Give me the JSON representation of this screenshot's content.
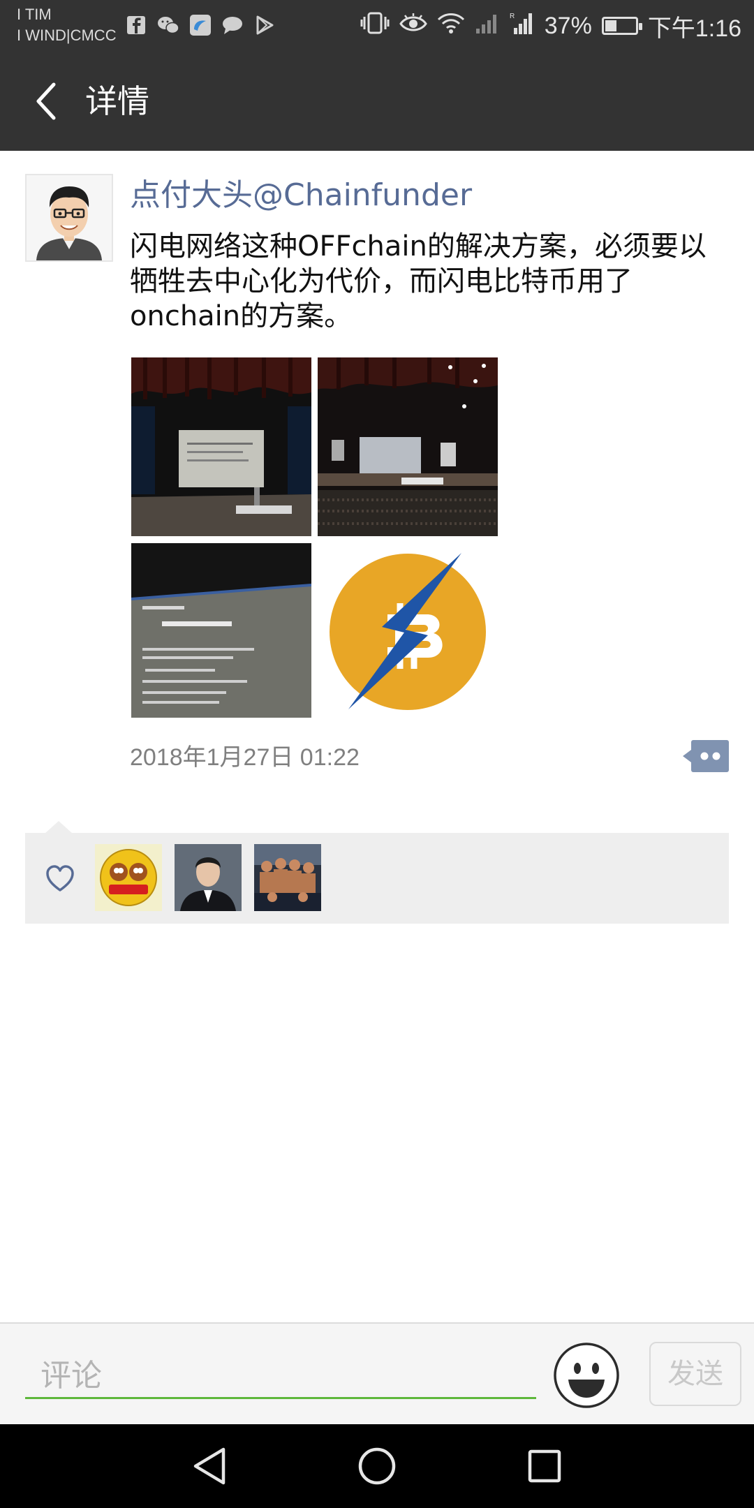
{
  "status_bar": {
    "carrier_1": "I TIM",
    "carrier_2": "I WIND|CMCC",
    "battery_percent": "37%",
    "battery_level": 0.37,
    "time": "下午1:16",
    "left_icons": [
      "facebook-icon",
      "wechat-icon",
      "tim-icon",
      "chat-bubble-icon",
      "play-store-icon"
    ],
    "right_icons": [
      "vibrate-icon",
      "eye-icon",
      "wifi-icon",
      "signal-1-icon",
      "signal-2-icon"
    ]
  },
  "header": {
    "title": "详情",
    "back_icon": "chevron-left-icon"
  },
  "post": {
    "author": "点付大头@Chainfunder",
    "text": "闪电网络这种OFFchain的解决方案，必须要以牺牲去中心化为代价，而闪电比特币用了onchain的方案。",
    "timestamp": "2018年1月27日 01:22",
    "images": [
      "conference-slide-photo",
      "conference-hall-photo",
      "slide-closeup-photo",
      "lightning-bitcoin-logo"
    ],
    "more_icon": "comment-more-icon"
  },
  "likes": {
    "icon": "heart-icon",
    "likers": [
      "liker-avatar-1",
      "liker-avatar-2",
      "liker-avatar-3"
    ]
  },
  "comment_bar": {
    "placeholder": "评论",
    "emoji_icon": "emoji-icon",
    "send_label": "发送"
  },
  "nav_bar": {
    "icons": [
      "nav-back-icon",
      "nav-home-icon",
      "nav-recents-icon"
    ]
  },
  "colors": {
    "header_bg": "#333333",
    "author_blue": "#576b95",
    "accent_green": "#5eb83c",
    "likes_bg": "#eeeeee"
  }
}
